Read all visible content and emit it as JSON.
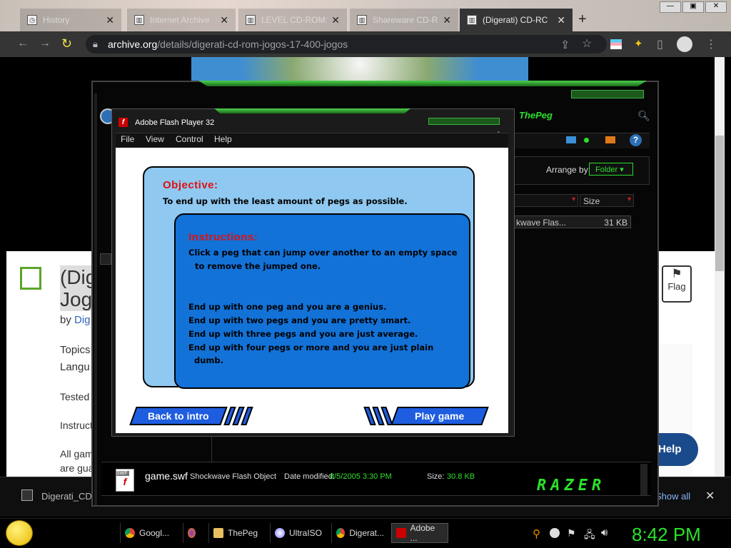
{
  "browser": {
    "tabs": [
      {
        "label": "History",
        "icon": "clock-icon",
        "active": false
      },
      {
        "label": "Internet Archive",
        "icon": "archive-icon",
        "active": false
      },
      {
        "label": "LEVEL CD-ROM:",
        "icon": "archive-icon",
        "active": false
      },
      {
        "label": "Shareware CD-R",
        "icon": "archive-icon",
        "active": false
      },
      {
        "label": "(Digerati) CD-RC",
        "icon": "archive-icon",
        "active": true
      }
    ],
    "new_tab": "+",
    "url_host": "archive.org",
    "url_path": "/details/digerati-cd-rom-jogos-17-400-jogos"
  },
  "archive_page": {
    "title_part1": "(Dig",
    "title_part2": "Jog",
    "by_label": "by",
    "by_name": "Dig",
    "topics": "Topics",
    "language": "Langu",
    "tested": "Tested",
    "instruct": "Instruct",
    "allgam": "All gam",
    "areguar": "are gua",
    "flag_label": "Flag",
    "help_label": "Help",
    "download_name": "Digerati_CD",
    "show_all": "Show all"
  },
  "thepeg_window": {
    "title": "ThePeg",
    "arrange_label": "Arrange by:",
    "arrange_value": "Folder",
    "col_size": "Size",
    "file_row_name": "kwave Flas...",
    "file_row_size": "31 KB",
    "status_filename": "game.swf",
    "status_type": "Shockwave Flash Object",
    "status_modified_label": "Date modified:",
    "status_modified_value": "8/5/2005 3:30 PM",
    "status_size_label": "Size:",
    "status_size_value": "30.8 KB",
    "brand": "RAZER",
    "swf_icon_label": "SWF"
  },
  "flash_window": {
    "title": "Adobe Flash Player 32",
    "menu": [
      "File",
      "View",
      "Control",
      "Help"
    ]
  },
  "game": {
    "objective_title": "Objective:",
    "objective_text": "To end up with the least amount of pegs as possible.",
    "instructions_title": "Instructions:",
    "instr_line1": "Click a peg that can jump over another to an empty space",
    "instr_line2": "to remove the jumped one.",
    "result1": "End up with one peg and you are a genius.",
    "result2": "End up with two pegs and you are pretty smart.",
    "result3": "End up with three pegs and you are just average.",
    "result4a": "End up with four pegs or more and you are just plain",
    "result4b": "dumb.",
    "back_button": "Back to intro",
    "play_button": "Play game"
  },
  "taskbar": {
    "items": [
      {
        "label": "Googl...",
        "icon": "chrome-icon"
      },
      {
        "label": "",
        "icon": "firefox-icon"
      },
      {
        "label": "ThePeg",
        "icon": "folder-icon"
      },
      {
        "label": "UltraISO",
        "icon": "ultraiso-icon"
      },
      {
        "label": "Digerat...",
        "icon": "chrome-icon"
      },
      {
        "label": "Adobe ...",
        "icon": "flash-icon"
      }
    ],
    "clock": "8:42 PM"
  },
  "colors": {
    "accent_green": "#2be02b",
    "game_blue": "#1272d8",
    "game_light_blue": "#8fc8f0",
    "game_red": "#e01010"
  }
}
